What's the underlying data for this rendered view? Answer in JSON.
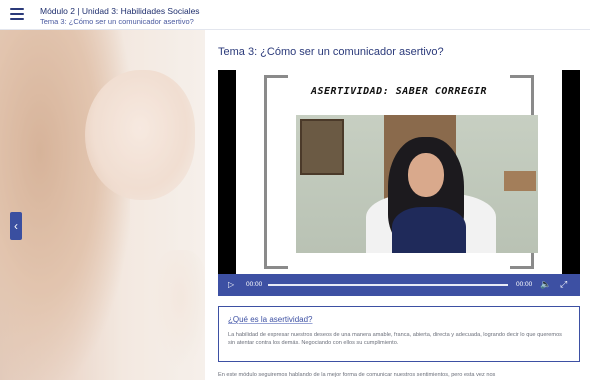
{
  "header": {
    "breadcrumb": "Módulo 2 | Unidad 3:  Habilidades Sociales",
    "subtitle": "Tema 3: ¿Cómo ser un comunicador asertivo?"
  },
  "icons": {
    "menu": "hamburger-menu-icon",
    "back": "chevron-left-icon",
    "play": "play-icon",
    "volume": "volume-icon",
    "fullscreen": "fullscreen-icon"
  },
  "main": {
    "title": "Tema 3: ¿Cómo ser un comunicador asertivo?",
    "video": {
      "slide_title": "ASERTIVIDAD: SABER CORREGIR",
      "time_current": "00:00",
      "time_total": "00:00",
      "progress": 0
    },
    "info_box": {
      "heading": "¿Qué es la asertividad?",
      "body": "La habilidad de expresar nuestros deseos de una manera amable, franca, abierta, directa y adecuada, logrando decir lo que queremos sin atentar contra los demás. Negociando con ellos su cumplimiento."
    },
    "footer_text": "En este módulo seguiremos hablando de la mejor forma de comunicar nuestros sentimientos, pero esta vez nos"
  },
  "colors": {
    "accent": "#3d50a3",
    "title": "#2b3a7a",
    "body_text": "#6b6f7a"
  }
}
